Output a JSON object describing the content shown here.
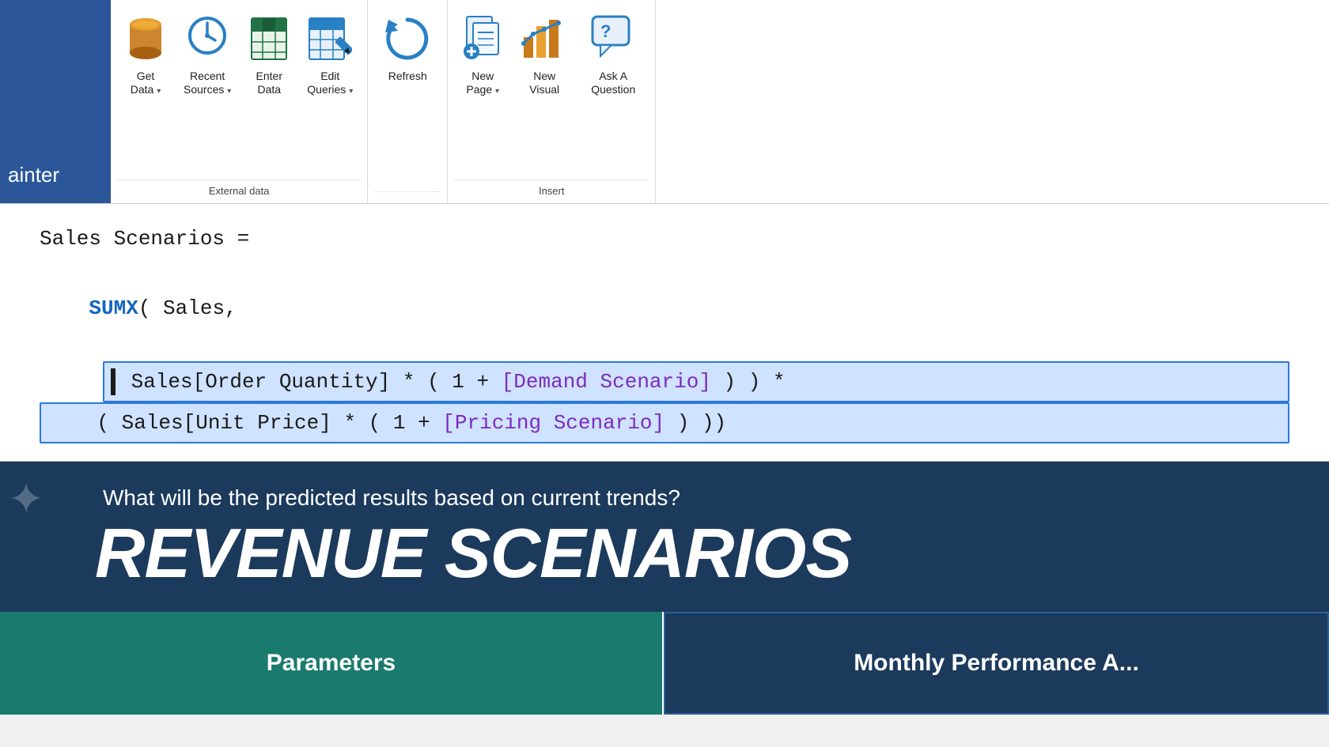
{
  "ribbon": {
    "left_label": "ainter",
    "groups": [
      {
        "name": "external-data",
        "label": "External data",
        "buttons": [
          {
            "id": "get-data",
            "line1": "Get",
            "line2": "Data",
            "dropdown": true,
            "icon": "cylinder"
          },
          {
            "id": "recent-sources",
            "line1": "Recent",
            "line2": "Sources",
            "dropdown": true,
            "icon": "clock"
          },
          {
            "id": "enter-data",
            "line1": "Enter",
            "line2": "Data",
            "dropdown": false,
            "icon": "table-enter"
          },
          {
            "id": "edit-queries",
            "line1": "Edit",
            "line2": "Queries",
            "dropdown": true,
            "icon": "table-edit"
          }
        ]
      },
      {
        "name": "refresh",
        "label": "",
        "buttons": [
          {
            "id": "refresh",
            "line1": "Refresh",
            "line2": "",
            "dropdown": false,
            "icon": "refresh"
          }
        ]
      },
      {
        "name": "insert",
        "label": "Insert",
        "buttons": [
          {
            "id": "new-page",
            "line1": "New",
            "line2": "Page",
            "dropdown": true,
            "icon": "newpage"
          },
          {
            "id": "new-visual",
            "line1": "New",
            "line2": "Visual",
            "dropdown": false,
            "icon": "barchart"
          },
          {
            "id": "ask-question",
            "line1": "Ask A",
            "line2": "Question",
            "dropdown": false,
            "icon": "chat"
          }
        ]
      }
    ]
  },
  "formula": {
    "line1": "Sales Scenarios =",
    "line2_prefix": "SUMX( Sales,",
    "line3_selected": "[ Sales[Order Quantity] * ( 1 + [Demand Scenario] ) ) *",
    "line4_selected": "( Sales[Unit Price] * ( 1 + [Pricing Scenario] ) ))",
    "demand_scenario": "[Demand Scenario]",
    "pricing_scenario": "[Pricing Scenario]"
  },
  "banner": {
    "subtitle": "What will be the predicted results based on current trends?",
    "title": "REVENUE SCENARIOS"
  },
  "cards": {
    "left": "Parameters",
    "right": "Monthly Performance A..."
  },
  "colors": {
    "ribbon_bg": "#ffffff",
    "ribbon_accent": "#2b579a",
    "code_bg": "#ffffff",
    "selected_bg": "#cfe2ff",
    "selected_border": "#2979d8",
    "banner_bg": "#1b3a5c",
    "card_teal": "#1a7a6e",
    "code_blue": "#1565c0",
    "code_purple": "#7b2cbf"
  }
}
